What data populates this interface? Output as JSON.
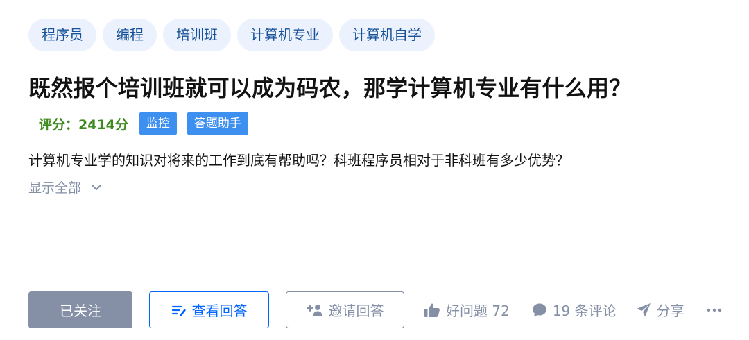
{
  "tags": [
    "程序员",
    "编程",
    "培训班",
    "计算机专业",
    "计算机自学"
  ],
  "question": {
    "title": "既然报个培训班就可以成为码农，那学计算机专业有什么用？",
    "score": "评分：2414分",
    "badges": [
      "监控",
      "答题助手"
    ],
    "description": "计算机专业学的知识对将来的工作到底有帮助吗？科班程序员相对于非科班有多少优势？",
    "show_all": "显示全部"
  },
  "actions": {
    "followed_label": "已关注",
    "view_answers_label": "查看回答",
    "invite_label": "邀请回答",
    "good_question": "好问题 72",
    "comments": "19 条评论",
    "share": "分享"
  },
  "colors": {
    "tag_bg": "#ebf2fd",
    "tag_text": "#175199",
    "score_green": "#3d8b1e",
    "badge_blue": "#3d8ff0",
    "primary_blue": "#0066ff",
    "gray": "#8590a6"
  },
  "icons": [
    "chevron-down-icon",
    "list-answer-icon",
    "add-user-icon",
    "thumb-up-icon",
    "comment-icon",
    "share-icon",
    "more-icon"
  ]
}
